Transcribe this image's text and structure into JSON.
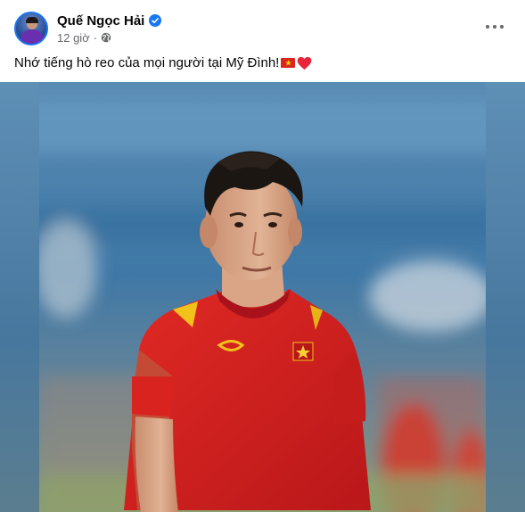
{
  "post": {
    "author": "Quế Ngọc Hải",
    "verified": true,
    "timestamp": "12 giờ",
    "separator": "·",
    "privacy_icon": "globe-icon",
    "caption": "Nhớ tiếng hò reo của mọi người tại Mỹ Đình!",
    "caption_emojis": [
      "vietnam-flag-icon",
      "red-heart-icon"
    ],
    "heart": "❤️",
    "more_icon": "more-horizontal-icon",
    "photo": "football-player-red-jersey",
    "colors": {
      "verified_badge": "#1877f2",
      "secondary_text": "#65676b",
      "jersey_red": "#d6201f",
      "stadium_blue": "#4f7fa6"
    }
  }
}
